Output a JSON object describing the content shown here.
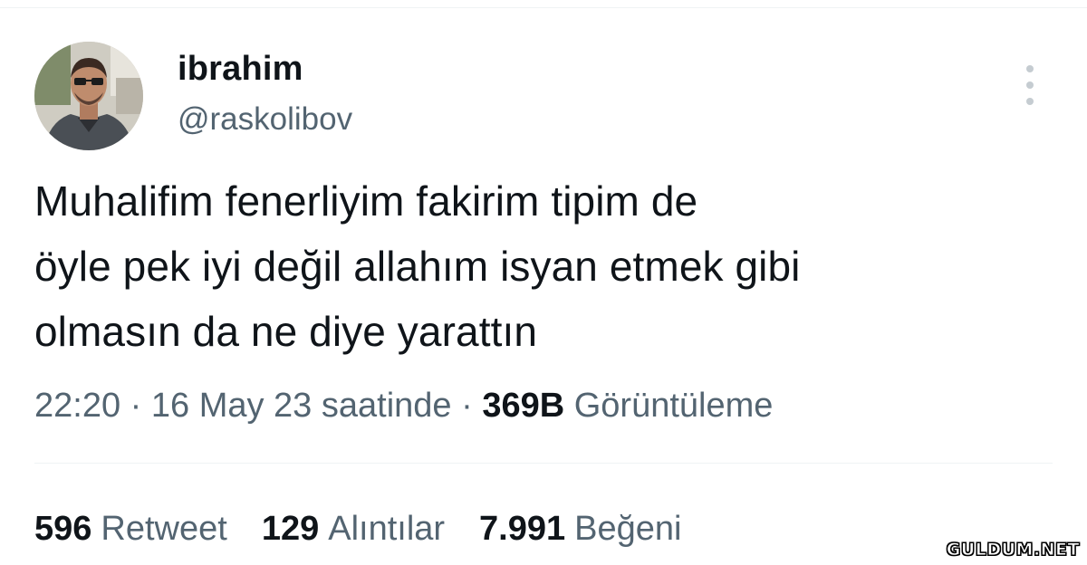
{
  "tweet": {
    "display_name": "ibrahim",
    "handle": "@raskolibov",
    "text": "Muhalifim fenerliyim fakirim tipim de\nöyle pek iyi değil allahım isyan etmek gibi\nolmasın da ne diye yarattın",
    "time": "22:20",
    "separator": "·",
    "date": "16 May 23 saatinde",
    "views_count": "369B",
    "views_label": "Görüntüleme",
    "more_icon": "more-vertical-icon",
    "avatar_icon": "profile-photo"
  },
  "stats": {
    "retweets": {
      "count": "596",
      "label": "Retweet"
    },
    "quotes": {
      "count": "129",
      "label": "Alıntılar"
    },
    "likes": {
      "count": "7.991",
      "label": "Beğeni"
    }
  },
  "watermark": {
    "text": "GULDUM.NET"
  },
  "colors": {
    "text_primary": "#0f1419",
    "text_secondary": "#536471",
    "divider": "#eff3f4",
    "background": "#ffffff"
  }
}
